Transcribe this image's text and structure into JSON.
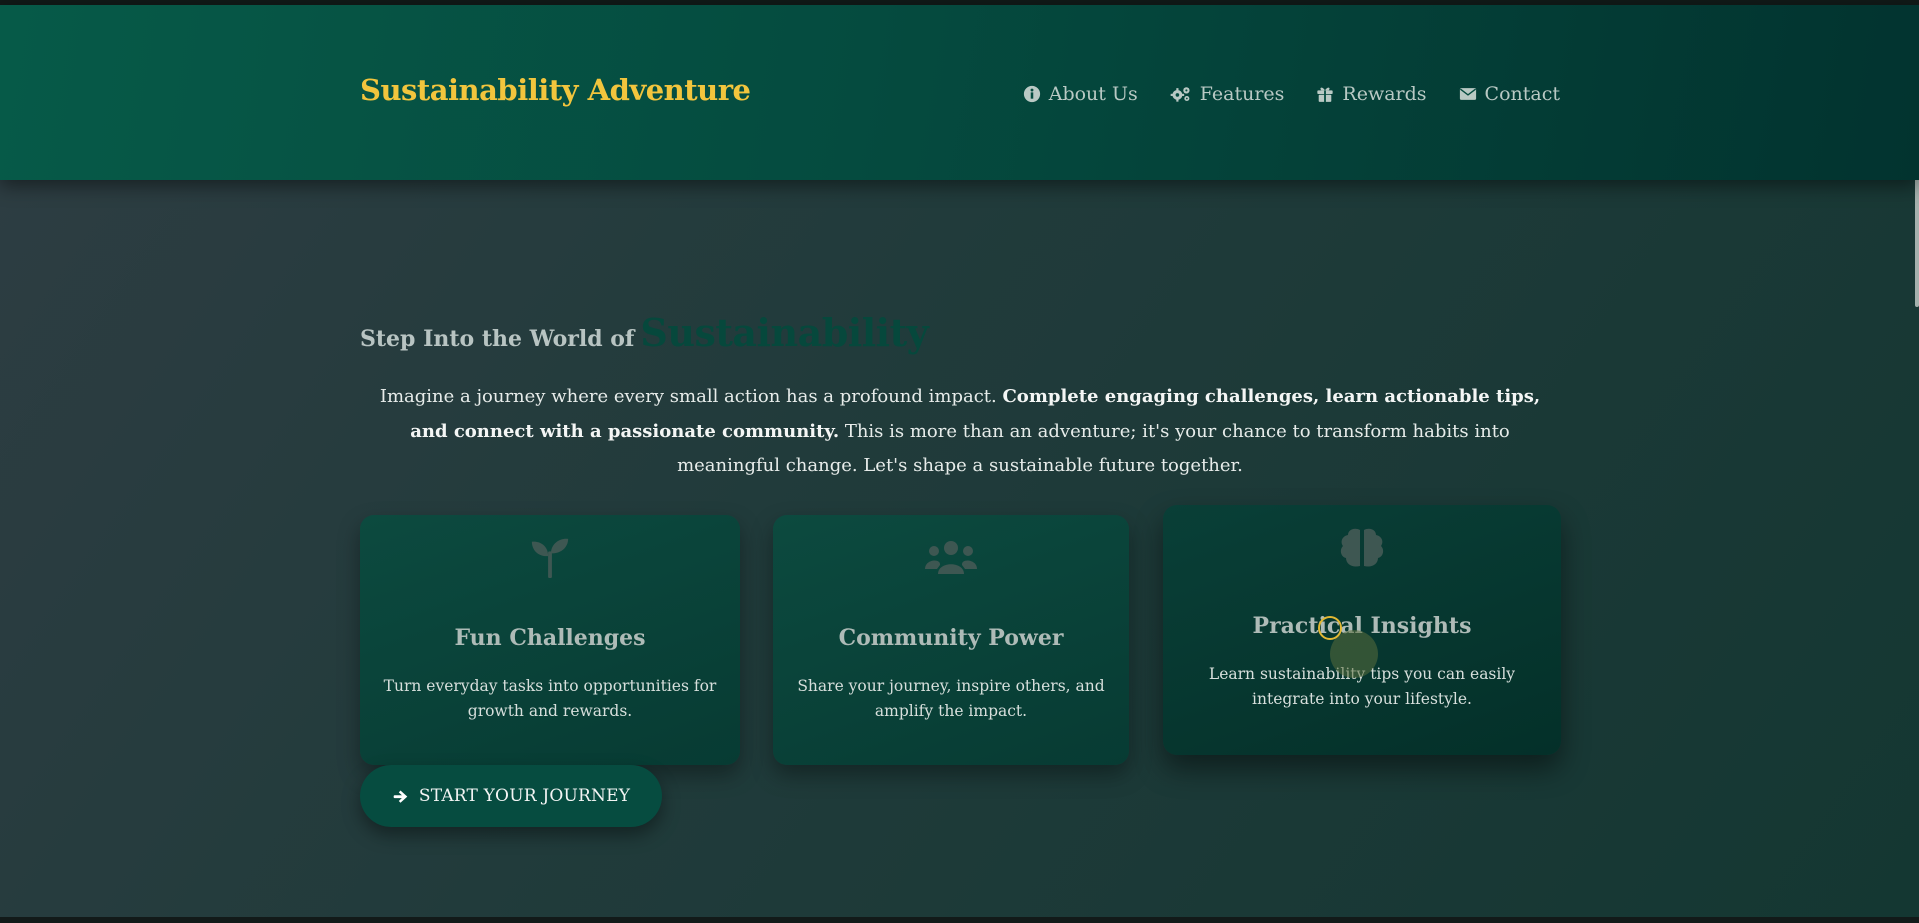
{
  "brand": {
    "title": "Sustainability Adventure",
    "color": "#f2c53d"
  },
  "nav": [
    {
      "label": "About Us",
      "icon": "info-circle-icon"
    },
    {
      "label": "Features",
      "icon": "gears-icon"
    },
    {
      "label": "Rewards",
      "icon": "gift-icon"
    },
    {
      "label": "Contact",
      "icon": "envelope-icon"
    }
  ],
  "hero": {
    "heading_prefix": "Step Into the World of",
    "heading_highlight": "Sustainability",
    "intro_start": "Imagine a journey where every small action has a profound impact. ",
    "intro_bold": "Complete engaging challenges, learn actionable tips, and connect with a passionate community.",
    "intro_end": " This is more than an adventure; it's your chance to transform habits into meaningful change. Let's shape a sustainable future together."
  },
  "cards": [
    {
      "title": "Fun Challenges",
      "description": "Turn everyday tasks into opportunities for growth and rewards.",
      "icon": "seedling-icon"
    },
    {
      "title": "Community Power",
      "description": "Share your journey, inspire others, and amplify the impact.",
      "icon": "users-icon"
    },
    {
      "title": "Practical Insights",
      "description": "Learn sustainability tips you can easily integrate into your lifestyle.",
      "icon": "brain-icon"
    }
  ],
  "cta": {
    "label": "START YOUR JOURNEY",
    "icon": "arrow-right-icon"
  },
  "colors": {
    "header": "#054b3f",
    "accent": "#f2c53d",
    "card": "#073b33"
  }
}
